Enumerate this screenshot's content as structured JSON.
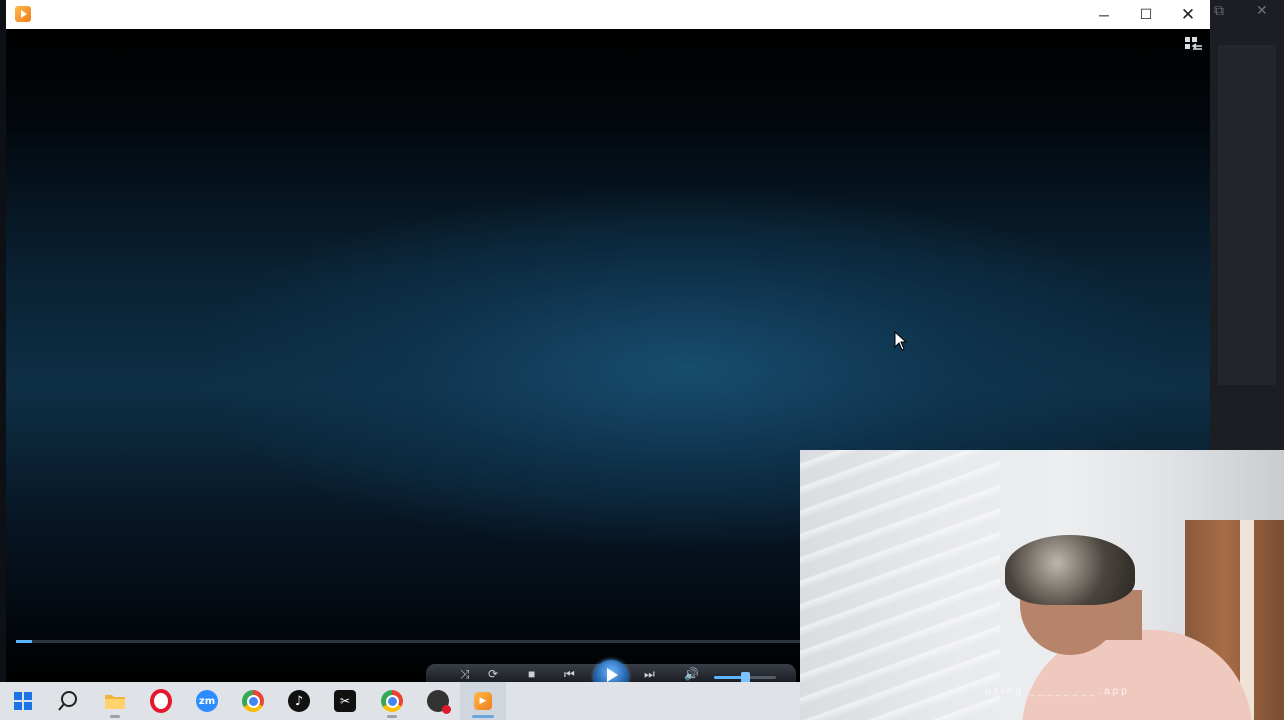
{
  "window": {
    "app_icon": "media-player-icon",
    "controls": {
      "minimize": "─",
      "maximize": "☐",
      "close": "✕"
    }
  },
  "background_window": {
    "controls": {
      "restore": "⧉",
      "close": "✕"
    }
  },
  "player": {
    "switch_view_icon": "switch-to-library-icon",
    "seek_progress_fraction": 0.02,
    "volume_fraction": 0.5,
    "controls": {
      "shuffle": "⤨",
      "repeat": "⟳",
      "stop": "■",
      "previous": "⏮",
      "play": "play-icon",
      "next": "⏭",
      "mute": "🔊"
    }
  },
  "taskbar": {
    "items": [
      {
        "name": "start",
        "icon": "windows-icon",
        "glyph": "",
        "color": "#1a73e8"
      },
      {
        "name": "search",
        "icon": "search-icon",
        "glyph": "",
        "color": "#222"
      },
      {
        "name": "file-explorer",
        "icon": "folder-icon",
        "glyph": "",
        "color": "#f2b33d"
      },
      {
        "name": "opera",
        "icon": "opera-icon",
        "glyph": "O",
        "color": "#e3182d"
      },
      {
        "name": "zoom",
        "icon": "zoom-icon",
        "glyph": "zm",
        "color": "#2d8cff"
      },
      {
        "name": "chrome",
        "icon": "chrome-icon",
        "glyph": "",
        "color": "#34a853"
      },
      {
        "name": "tiktok",
        "icon": "tiktok-icon",
        "glyph": "♪",
        "color": "#111"
      },
      {
        "name": "capcut",
        "icon": "capcut-icon",
        "glyph": "✂",
        "color": "#111"
      },
      {
        "name": "chrome-profile",
        "icon": "chrome-profile-icon",
        "glyph": "",
        "color": "#34a853"
      },
      {
        "name": "screen-recorder",
        "icon": "screen-recorder-icon",
        "glyph": "●",
        "color": "#333"
      },
      {
        "name": "media-player",
        "icon": "media-player-icon",
        "glyph": "▶",
        "color": "#f39a2a"
      }
    ]
  },
  "webcam": {
    "watermark": "using ________.app"
  }
}
